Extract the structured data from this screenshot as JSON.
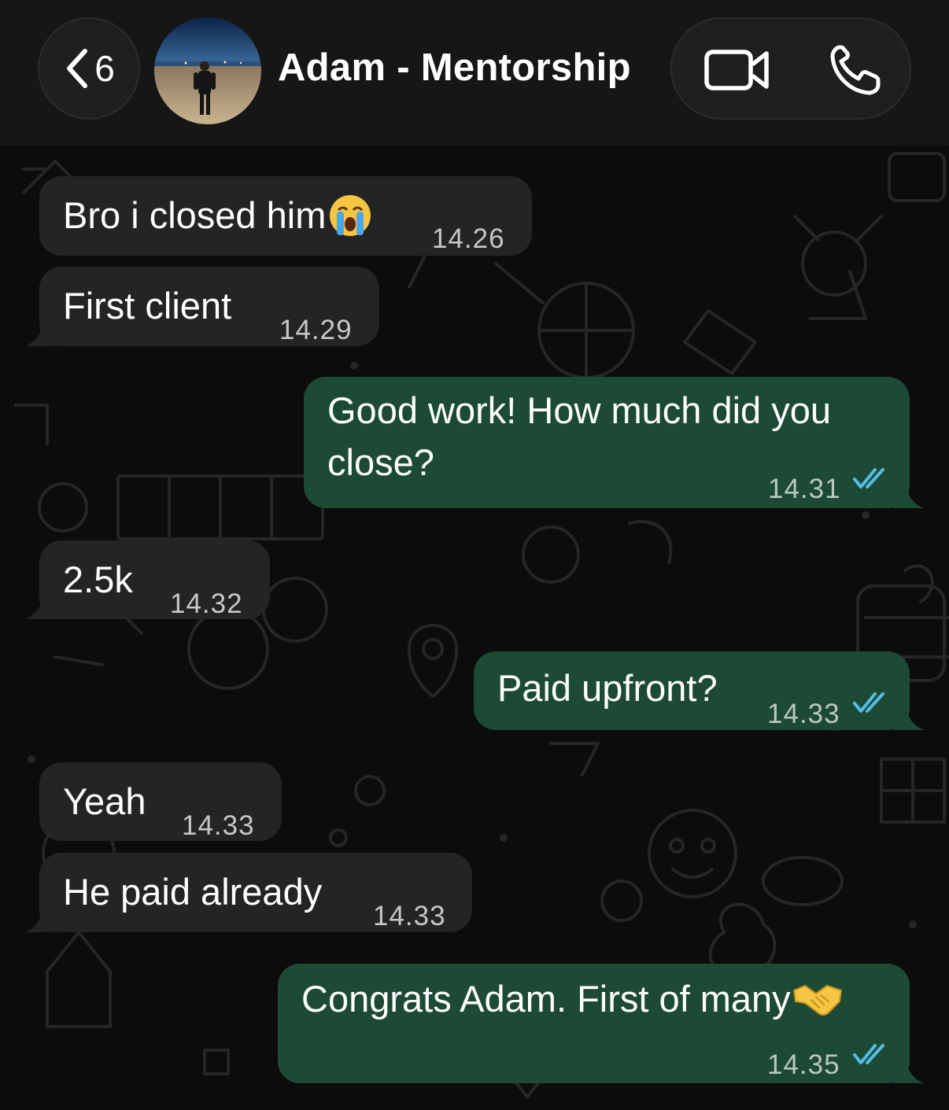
{
  "header": {
    "back_count": "6",
    "title": "Adam - Mentorship"
  },
  "messages": [
    {
      "direction": "in",
      "text": "Bro i closed him",
      "emoji": "crying-face",
      "time": "14.26"
    },
    {
      "direction": "in",
      "text": "First client",
      "time": "14.29"
    },
    {
      "direction": "out",
      "text_line1": "Good work! How much did you",
      "text_line2": "close?",
      "time": "14.31",
      "status": "read"
    },
    {
      "direction": "in",
      "text": "2.5k",
      "time": "14.32"
    },
    {
      "direction": "out",
      "text": "Paid upfront?",
      "time": "14.33",
      "status": "read"
    },
    {
      "direction": "in",
      "text": "Yeah",
      "time": "14.33"
    },
    {
      "direction": "in",
      "text": "He paid already",
      "time": "14.33"
    },
    {
      "direction": "out",
      "text": "Congrats Adam. First of many",
      "emoji": "handshake",
      "time": "14.35",
      "status": "read"
    }
  ],
  "colors": {
    "header_bg": "#161616",
    "incoming_bubble": "#242424",
    "outgoing_bubble": "#1c4a34",
    "read_tick": "#53bdeb"
  }
}
